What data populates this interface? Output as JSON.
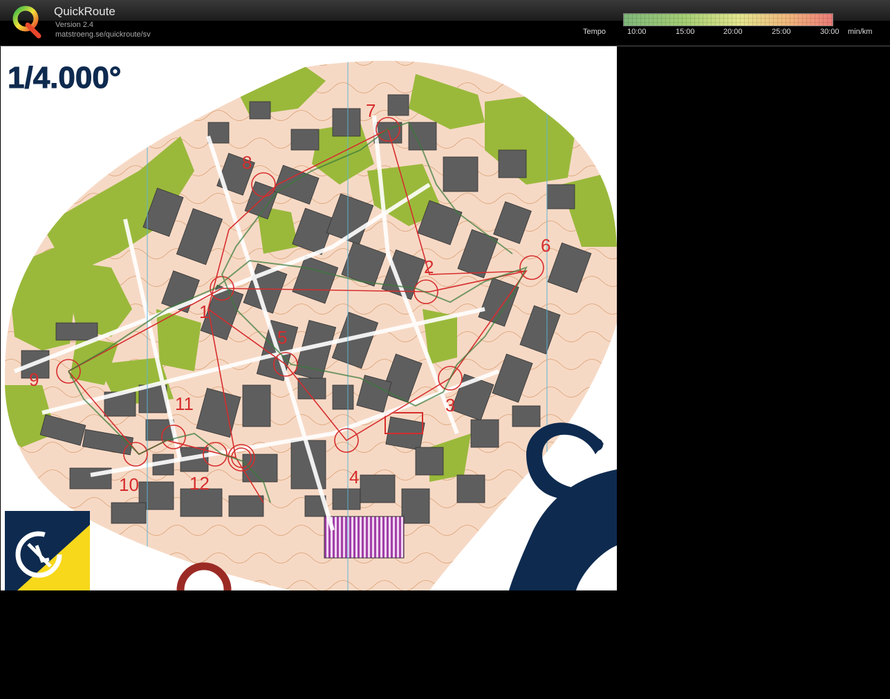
{
  "app": {
    "title": "QuickRoute",
    "version": "Version 2.4",
    "url": "matstroeng.se/quickroute/sv"
  },
  "legend": {
    "label": "Tempo",
    "ticks": [
      "10:00",
      "15:00",
      "20:00",
      "25:00",
      "30:00"
    ],
    "unit": "min/km",
    "colors": [
      "#7fb87a",
      "#a6cf74",
      "#e3e68e",
      "#f1b97d",
      "#ec7b78"
    ]
  },
  "map": {
    "scale_text": "1/4.000°",
    "control_numbers": [
      "1",
      "2",
      "3",
      "4",
      "5",
      "6",
      "7",
      "8",
      "9",
      "10",
      "11",
      "12"
    ],
    "colors": {
      "paved": "#f6d9c5",
      "building": "#5e5e5e",
      "vegetation": "#9ab93b",
      "course": "#d62d2d",
      "contour": "#c77a3b",
      "logo_navy": "#0e2a4f",
      "logo_yellow": "#f7d81b"
    }
  }
}
